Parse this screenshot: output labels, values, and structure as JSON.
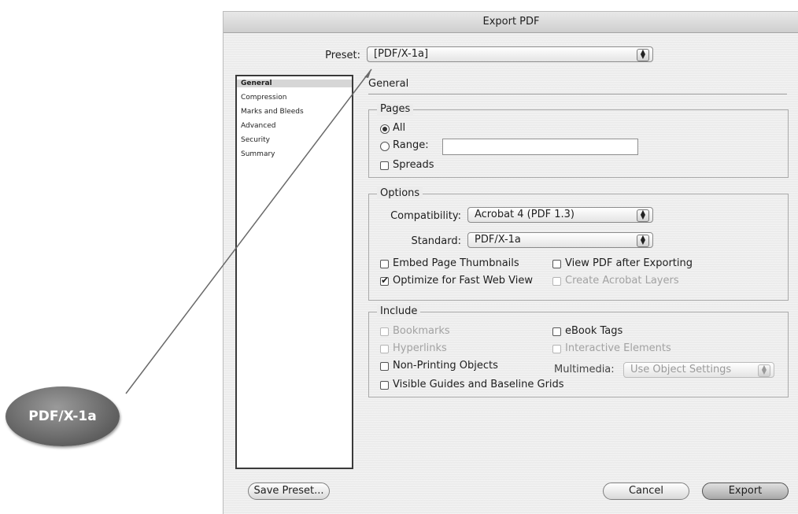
{
  "dialog": {
    "title": "Export PDF"
  },
  "preset": {
    "label": "Preset:",
    "value": "[PDF/X-1a]"
  },
  "sidebar": {
    "items": [
      "General",
      "Compression",
      "Marks and Bleeds",
      "Advanced",
      "Security",
      "Summary"
    ],
    "selected": "General"
  },
  "panel": {
    "title": "General"
  },
  "pages": {
    "title": "Pages",
    "all_label": "All",
    "range_label": "Range:",
    "range_value": "",
    "spreads_label": "Spreads",
    "selected": "All"
  },
  "options": {
    "title": "Options",
    "compatibility_label": "Compatibility:",
    "compatibility_value": "Acrobat 4 (PDF 1.3)",
    "standard_label": "Standard:",
    "standard_value": "PDF/X-1a",
    "embed_thumbnails": "Embed Page Thumbnails",
    "view_after_export": "View PDF after Exporting",
    "optimize_web": "Optimize for Fast Web View",
    "acrobat_layers": "Create Acrobat Layers"
  },
  "include": {
    "title": "Include",
    "bookmarks": "Bookmarks",
    "hyperlinks": "Hyperlinks",
    "non_printing": "Non-Printing Objects",
    "guides": "Visible Guides and Baseline Grids",
    "ebook_tags": "eBook Tags",
    "interactive": "Interactive Elements",
    "multimedia_label": "Multimedia:",
    "multimedia_value": "Use Object Settings"
  },
  "buttons": {
    "save_preset": "Save Preset...",
    "cancel": "Cancel",
    "export": "Export"
  },
  "callout": {
    "label": "PDF/X-1a"
  },
  "icons": {
    "popup_arrows": "▲▼"
  },
  "colors": {
    "dialog_bg": "#ececec",
    "callout": "#6e6e6e"
  }
}
